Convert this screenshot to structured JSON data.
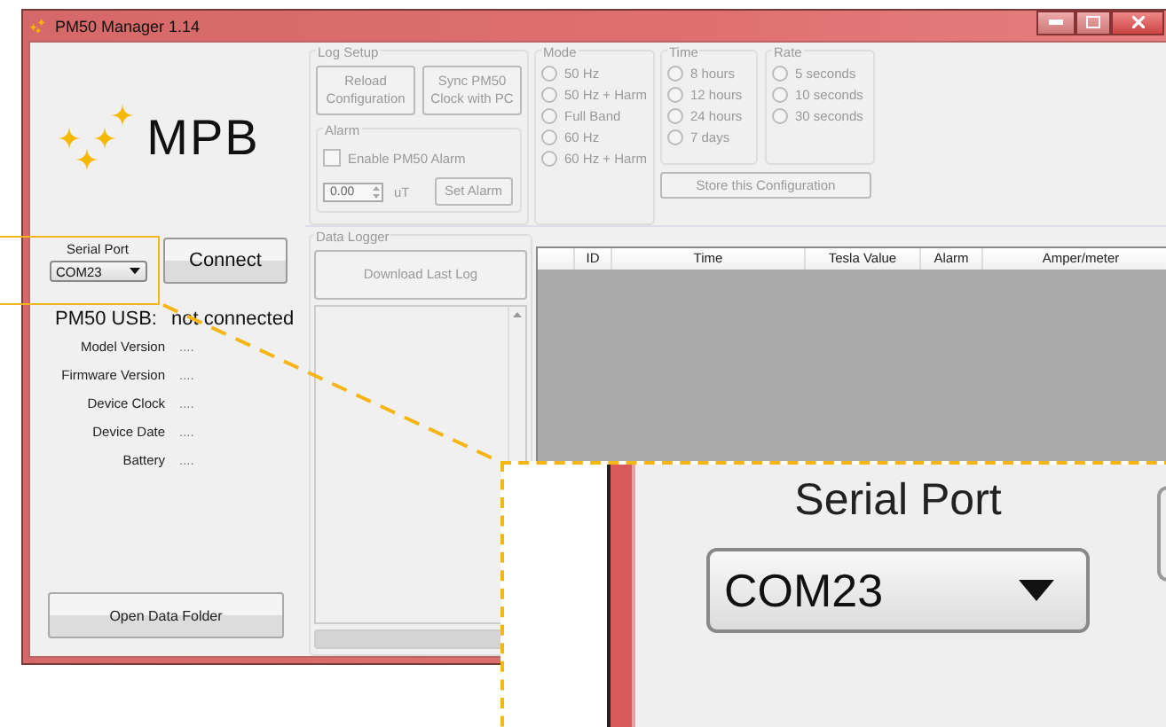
{
  "window": {
    "title": "PM50 Manager 1.14"
  },
  "logo": {
    "text": "MPB"
  },
  "serial_port": {
    "label": "Serial Port",
    "value": "COM23"
  },
  "connect_button": "Connect",
  "status": {
    "label": "PM50 USB:",
    "value": "not connected"
  },
  "info": [
    {
      "label": "Model Version",
      "value": "...."
    },
    {
      "label": "Firmware Version",
      "value": "...."
    },
    {
      "label": "Device Clock",
      "value": "...."
    },
    {
      "label": "Device Date",
      "value": "...."
    },
    {
      "label": "Battery",
      "value": "...."
    }
  ],
  "open_folder_button": "Open Data Folder",
  "log_setup": {
    "title": "Log Setup",
    "disabled": true,
    "buttons": [
      "Reload Configuration",
      "Sync PM50 Clock with PC"
    ],
    "alarm": {
      "title": "Alarm",
      "enable_label": "Enable PM50 Alarm",
      "checked": false,
      "value": "0.00",
      "unit": "uT",
      "button": "Set Alarm"
    }
  },
  "mode": {
    "title": "Mode",
    "options": [
      {
        "label": "50 Hz",
        "selected": false
      },
      {
        "label": "50 Hz + Harm",
        "selected": false
      },
      {
        "label": "Full Band",
        "selected": false
      },
      {
        "label": "60 Hz",
        "selected": false
      },
      {
        "label": "60 Hz + Harm",
        "selected": false
      }
    ]
  },
  "time": {
    "title": "Time",
    "options": [
      {
        "label": "8 hours",
        "selected": false
      },
      {
        "label": "12 hours",
        "selected": false
      },
      {
        "label": "24 hours",
        "selected": false
      },
      {
        "label": "7 days",
        "selected": false
      }
    ]
  },
  "rate": {
    "title": "Rate",
    "options": [
      {
        "label": "5 seconds",
        "selected": false
      },
      {
        "label": "10 seconds",
        "selected": false
      },
      {
        "label": "30 seconds",
        "selected": false
      }
    ]
  },
  "store_button": "Store this Configuration",
  "data_logger": {
    "title": "Data Logger",
    "download_button": "Download Last Log",
    "progress": {
      "level": 0
    }
  },
  "table": {
    "columns": [
      "ID",
      "Time",
      "Tesla Value",
      "Alarm",
      "Amper/meter"
    ]
  },
  "callout": {
    "label": "Serial Port",
    "value": "COM23"
  }
}
